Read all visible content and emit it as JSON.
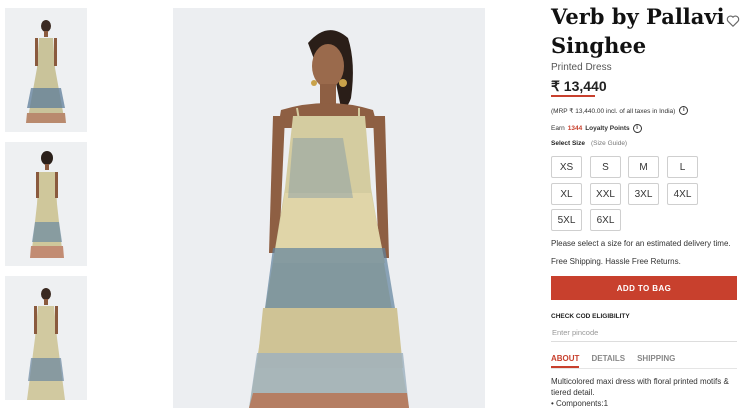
{
  "product": {
    "brand": "Verb by Pallavi Singhee",
    "type": "Printed Dress",
    "price": "₹ 13,440",
    "mrp_note": "(MRP ₹ 13,440.00 incl. of all taxes in India)",
    "loyalty_prefix": "Earn",
    "loyalty_points": "1344",
    "loyalty_suffix": "Loyalty Points",
    "select_size": "Select Size",
    "size_guide": "(Size Guide)",
    "sizes": [
      "XS",
      "S",
      "M",
      "L",
      "XL",
      "XXL",
      "3XL",
      "4XL",
      "5XL",
      "6XL"
    ],
    "delivery_note": "Please select a size for an estimated delivery time.",
    "shipping_note": "Free Shipping. Hassle Free Returns.",
    "add_to_bag": "ADD TO BAG",
    "cod_title": "CHECK COD ELIGIBILITY",
    "pincode_placeholder": "Enter pincode",
    "tabs": [
      "ABOUT",
      "DETAILS",
      "SHIPPING"
    ],
    "description": "Multicolored maxi dress with floral printed motifs & tiered detail.",
    "components": "• Components:1"
  },
  "colors": {
    "accent": "#c8402d"
  },
  "icons": {
    "wishlist": "heart-icon",
    "info": "info-icon"
  }
}
